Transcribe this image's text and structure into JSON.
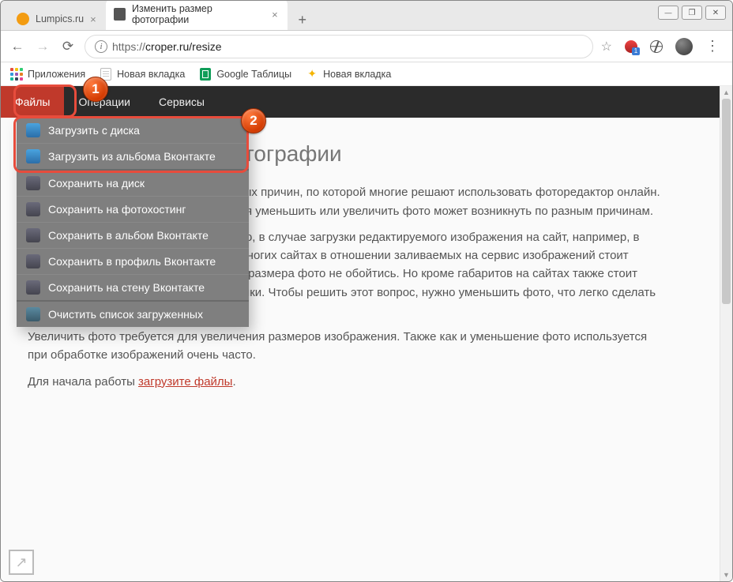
{
  "app": {
    "window_controls": {
      "minimize": true,
      "maximize": true,
      "close": true
    },
    "tabs": [
      {
        "title": "Lumpics.ru",
        "active": false,
        "favicon_color": "#f39c12"
      },
      {
        "title": "Изменить размер фотографии",
        "active": true,
        "favicon_color": "#555555"
      }
    ],
    "nav": {
      "back": true,
      "forward_disabled": true,
      "reload": true
    },
    "url": {
      "scheme_label": "https://",
      "host_path": "croper.ru/resize"
    },
    "toolbar_right": {
      "star": "☆",
      "menu": "⋮"
    },
    "bookmarks": [
      {
        "label": "Приложения",
        "icon": "apps"
      },
      {
        "label": "Новая вкладка",
        "icon": "doc"
      },
      {
        "label": "Google Таблицы",
        "icon": "sheet"
      },
      {
        "label": "Новая вкладка",
        "icon": "spark"
      }
    ]
  },
  "site_menu": {
    "items": [
      "Файлы",
      "Операции",
      "Сервисы"
    ],
    "active_index": 0
  },
  "dropdown": {
    "groups": [
      [
        {
          "icon": "upload",
          "label": "Загрузить с диска"
        },
        {
          "icon": "upload",
          "label": "Загрузить из альбома Вконтакте"
        }
      ],
      [
        {
          "icon": "save",
          "label": "Сохранить на диск"
        },
        {
          "icon": "save",
          "label": "Сохранить на фотохостинг"
        },
        {
          "icon": "save",
          "label": "Сохранить в альбом Вконтакте"
        },
        {
          "icon": "save",
          "label": "Сохранить в профиль Вконтакте"
        },
        {
          "icon": "save",
          "label": "Сохранить на стену Вконтакте"
        }
      ],
      [
        {
          "icon": "clear",
          "label": "Очистить список загруженных"
        }
      ]
    ]
  },
  "content": {
    "h1_full": "Изменить размер фотографии",
    "p1": "Изменить размер фото — одна из частых причин, по которой многие решают использовать фоторедактор онлайн. И причин для того, чтобы потребоваться уменьшить или увеличить фото может возникнуть по разным причинам.",
    "p2": "Уменьшить фото требуется, как правило, в случае загрузки редактируемого изображения на сайт, например, в фотоальбом Вконтакте. Поскольку на многих сайтах в отношении заливаемых на сервис изображений стоит ограничение размера, и без изменения размера фото не обойтись. Но кроме габаритов на сайтах также стоит ограничение и в отношении веса картинки. Чтобы решить этот вопрос, нужно уменьшить фото, что легко сделать здесь.",
    "p3": "Увеличить фото требуется для увеличения размеров изображения. Также как и уменьшение фото используется при обработке изображений очень часто.",
    "cta_prefix": "Для начала работы ",
    "cta_link": "загрузите файлы",
    "cta_suffix": "."
  },
  "annotations": {
    "badge1": "1",
    "badge2": "2"
  }
}
